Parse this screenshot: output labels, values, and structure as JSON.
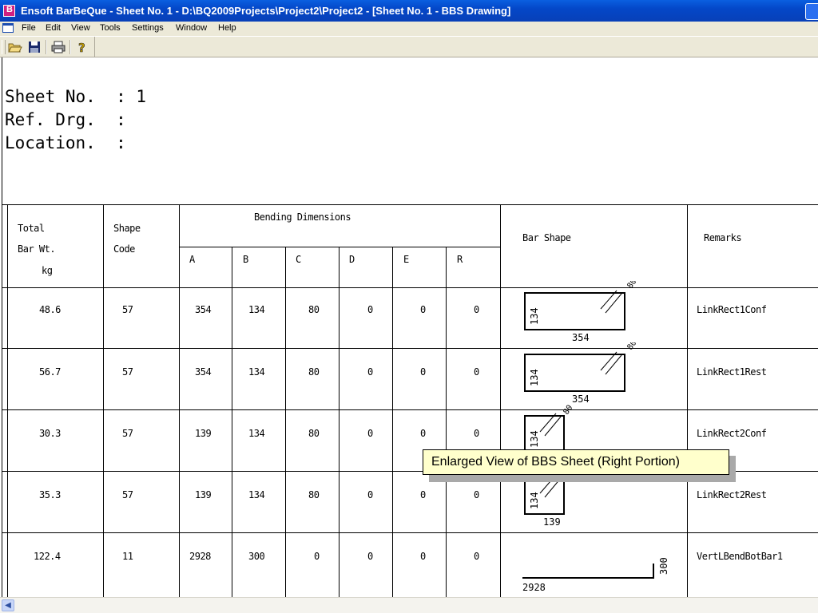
{
  "window": {
    "title": "Ensoft BarBeQue - Sheet No.  1 - D:\\BQ2009Projects\\Project2\\Project2 - [Sheet No. 1 -  BBS Drawing]"
  },
  "menu": [
    "File",
    "Edit",
    "View",
    "Tools",
    "Settings",
    "Window",
    "Help"
  ],
  "toolbar": {
    "buttons": [
      "open-icon",
      "save-icon",
      "print-icon",
      "help-icon"
    ]
  },
  "sheet_header": {
    "line1": "Sheet No.  : 1",
    "line2": "Ref. Drg.  :",
    "line3": "Location.  :"
  },
  "table": {
    "headers": {
      "total_bar_wt": [
        "Total",
        "Bar Wt.",
        "kg"
      ],
      "shape_code": [
        "Shape",
        "Code"
      ],
      "bending_dimensions": "Bending Dimensions",
      "dims": [
        "A",
        "B",
        "C",
        "D",
        "E",
        "R"
      ],
      "bar_shape": "Bar Shape",
      "remarks": "Remarks"
    },
    "rows": [
      {
        "wt": "48.6",
        "code": "57",
        "A": "354",
        "B": "134",
        "C": "80",
        "D": "0",
        "E": "0",
        "R": "0",
        "remarks": "LinkRect1Conf",
        "shape": {
          "type": "rect",
          "side": "134",
          "bottom": "354"
        }
      },
      {
        "wt": "56.7",
        "code": "57",
        "A": "354",
        "B": "134",
        "C": "80",
        "D": "0",
        "E": "0",
        "R": "0",
        "remarks": "LinkRect1Rest",
        "shape": {
          "type": "rect",
          "side": "134",
          "bottom": "354"
        }
      },
      {
        "wt": "30.3",
        "code": "57",
        "A": "139",
        "B": "134",
        "C": "80",
        "D": "0",
        "E": "0",
        "R": "0",
        "remarks": "LinkRect2Conf",
        "shape": {
          "type": "rect",
          "side": "134",
          "bottom": ""
        }
      },
      {
        "wt": "35.3",
        "code": "57",
        "A": "139",
        "B": "134",
        "C": "80",
        "D": "0",
        "E": "0",
        "R": "0",
        "remarks": "LinkRect2Rest",
        "shape": {
          "type": "rect",
          "side": "134",
          "bottom": "139"
        }
      },
      {
        "wt": "122.4",
        "code": "11",
        "A": "2928",
        "B": "300",
        "C": "0",
        "D": "0",
        "E": "0",
        "R": "0",
        "remarks": "VertLBendBotBar1",
        "shape": {
          "type": "lbend",
          "side": "300",
          "bottom": "2928"
        }
      }
    ]
  },
  "shape_labels": {
    "hook": "80"
  },
  "callout": {
    "text": "Enlarged View of BBS Sheet (Right Portion)"
  },
  "colors": {
    "titlebar": "#0447c8",
    "chrome": "#ece9d8",
    "callout_bg": "#ffffcc"
  }
}
